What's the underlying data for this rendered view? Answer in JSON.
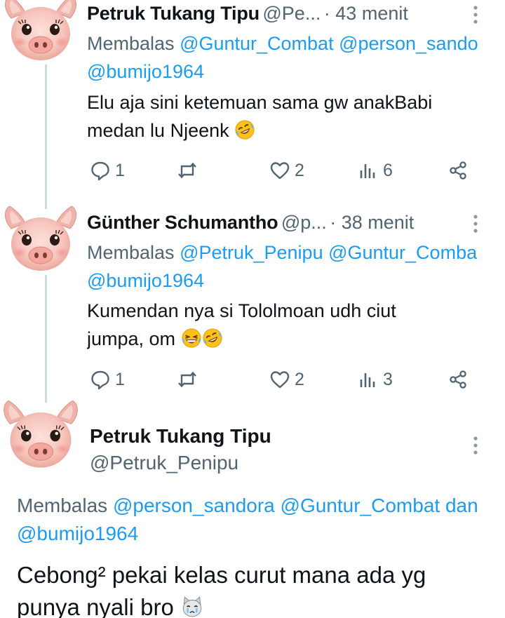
{
  "replies": [
    {
      "name": "Petruk Tukang Tipu",
      "handle": "@Pe...",
      "time": "· 43 menit",
      "reply_prefix": "Membalas",
      "reply_mentions_line1": "@Guntur_Combat @person_sando",
      "reply_mentions_line2": "@bumijo1964",
      "text_line1": "Elu aja sini ketemuan sama gw anakBabi",
      "text_line2": "medan lu Njeenk",
      "emojis": [
        "rofl"
      ],
      "counts": {
        "reply": "1",
        "retweet": "",
        "like": "2",
        "views": "6"
      }
    },
    {
      "name": "Günther Schumantho",
      "handle": "@p...",
      "time": "· 38 menit",
      "reply_prefix": "Membalas",
      "reply_mentions_line1": "@Petruk_Penipu @Guntur_Comba",
      "reply_mentions_line2": "@bumijo1964",
      "text_line1": "Kumendan nya si Tololmoan udh ciut",
      "text_line2": "jumpa, om",
      "emojis": [
        "laughing",
        "rofl"
      ],
      "counts": {
        "reply": "1",
        "retweet": "",
        "like": "2",
        "views": "3"
      }
    }
  ],
  "main": {
    "name": "Petruk Tukang Tipu",
    "handle": "@Petruk_Penipu",
    "reply_prefix": "Membalas",
    "reply_mentions_line1": "@person_sandora @Guntur_Combat dan",
    "reply_mentions_line2": "@bumijo1964",
    "text_line1": "Cebong² pekai kelas curut mana ada yg",
    "text_line2": "punya nyali bro",
    "emojis": [
      "crying-cat"
    ]
  },
  "icons": {
    "avatar": "pig-face-avatar",
    "more": "more-vertical-icon",
    "reply": "reply-icon",
    "retweet": "retweet-icon",
    "like": "heart-icon",
    "views": "views-icon",
    "share": "share-icon"
  },
  "colors": {
    "text": "#0f1419",
    "secondary": "#536471",
    "mention": "#1d9bf0",
    "thread_line": "#cfd9de"
  }
}
